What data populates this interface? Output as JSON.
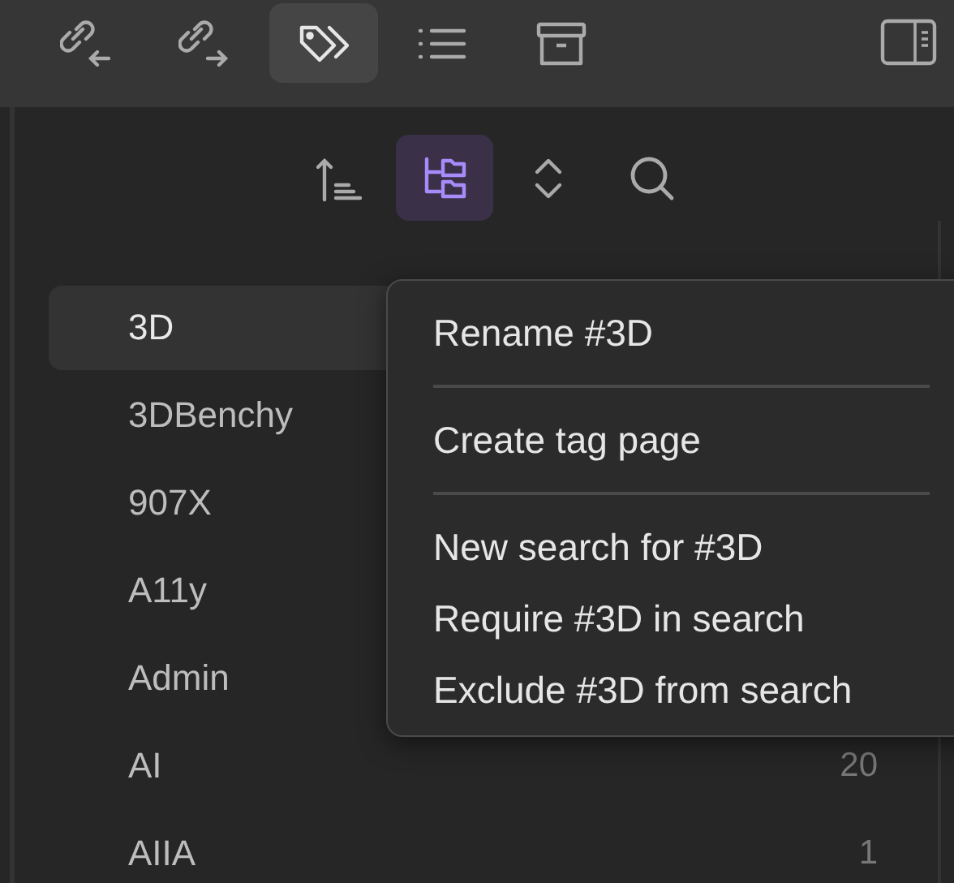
{
  "toolbar": {
    "tabs": [
      {
        "kind": "backlinks",
        "selected": false
      },
      {
        "kind": "outgoing",
        "selected": false
      },
      {
        "kind": "tags",
        "selected": true
      },
      {
        "kind": "outline",
        "selected": false
      },
      {
        "kind": "archive",
        "selected": false
      }
    ]
  },
  "tag_toolbar": {
    "buttons": [
      {
        "kind": "sort",
        "selected": false
      },
      {
        "kind": "tree",
        "selected": true
      },
      {
        "kind": "collapse",
        "selected": false
      },
      {
        "kind": "search",
        "selected": false
      }
    ]
  },
  "tags": [
    {
      "name": "3D",
      "selected": true
    },
    {
      "name": "3DBenchy",
      "selected": false
    },
    {
      "name": "907X",
      "selected": false
    },
    {
      "name": "A11y",
      "selected": false
    },
    {
      "name": "Admin",
      "selected": false
    },
    {
      "name": "AI",
      "count": "20",
      "selected": false
    },
    {
      "name": "AIIA",
      "count": "1",
      "selected": false
    }
  ],
  "context_menu": {
    "groups": [
      [
        "Rename #3D"
      ],
      [
        "Create tag page"
      ],
      [
        "New search for #3D",
        "Require #3D in search",
        "Exclude #3D from search"
      ]
    ]
  }
}
